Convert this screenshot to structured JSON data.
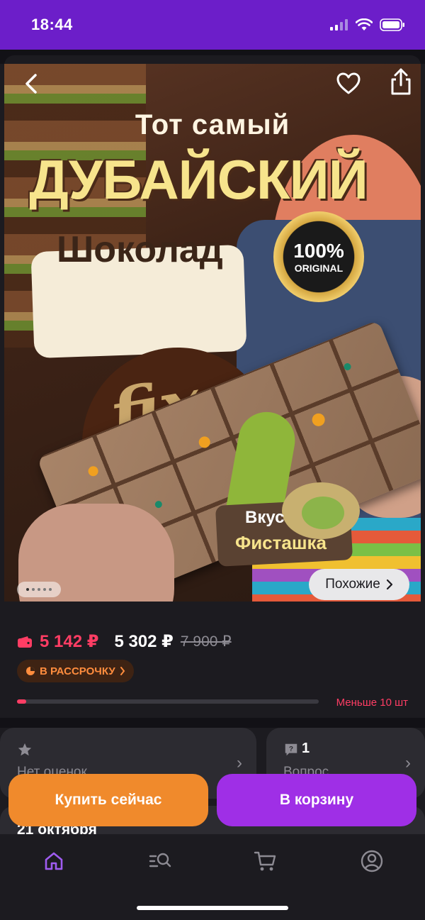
{
  "status_bar": {
    "time": "18:44"
  },
  "gallery": {
    "image_text": {
      "line1": "Тот самый",
      "line2": "ДУБАЙСКИЙ",
      "line3": "Шоколад",
      "seal_main": "100%",
      "seal_sub": "ORIGINAL",
      "brand": "fix",
      "flavor_label": "Вкус",
      "flavor_name": "Фисташка"
    },
    "page_count": 5,
    "active_page": 1,
    "similar_label": "Похожие"
  },
  "price": {
    "wallet_price": "5 142 ₽",
    "price": "5 302 ₽",
    "old_price": "7 900 ₽",
    "installment_label": "В РАССРОЧКУ"
  },
  "stock": {
    "label": "Меньше 10 шт",
    "level_fraction": 0.03
  },
  "rating_card": {
    "label": "Нет оценок"
  },
  "questions_card": {
    "count": "1",
    "label": "Вопрос"
  },
  "delivery": {
    "date": "21 октября"
  },
  "actions": {
    "buy_now": "Купить сейчас",
    "add_to_cart": "В корзину"
  },
  "colors": {
    "brand_purple": "#6c1ec9",
    "cart_purple": "#9f2fe6",
    "buy_orange": "#f08a2c",
    "price_red": "#ff3d64",
    "active_tab": "#9f5cf0"
  },
  "tabs": [
    {
      "icon": "home-icon",
      "active": true
    },
    {
      "icon": "catalog-search-icon",
      "active": false
    },
    {
      "icon": "cart-icon",
      "active": false
    },
    {
      "icon": "profile-icon",
      "active": false
    }
  ]
}
